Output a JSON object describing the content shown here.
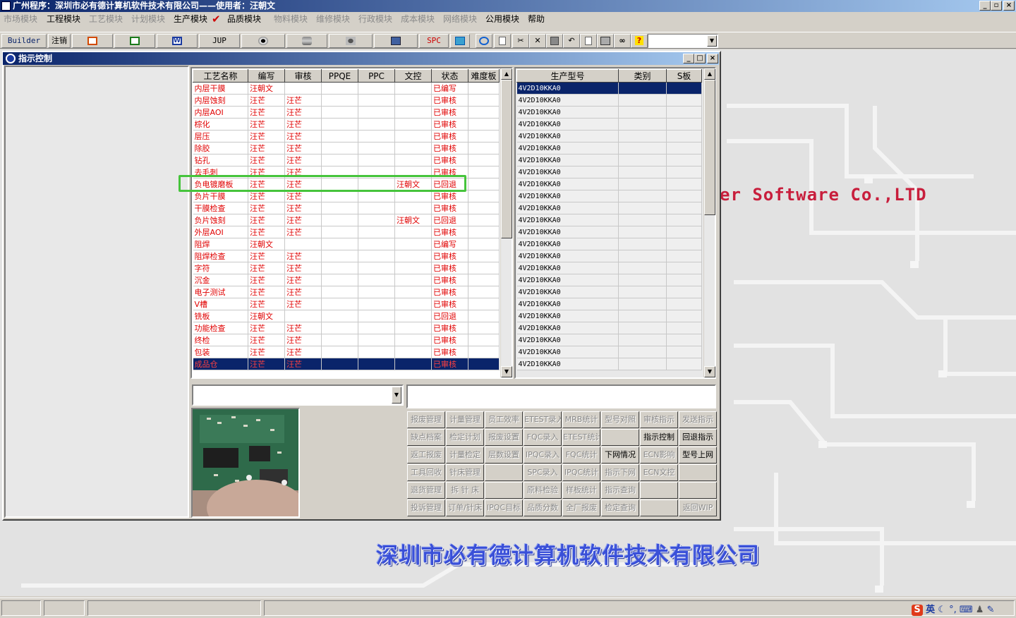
{
  "app": {
    "title": "广州程序：深圳市必有德计算机软件技术有限公司——使用者：汪朝文"
  },
  "menu": [
    {
      "label": "市场模块",
      "enabled": false
    },
    {
      "label": "工程模块",
      "enabled": true
    },
    {
      "label": "工艺模块",
      "enabled": false
    },
    {
      "label": "计划模块",
      "enabled": false
    },
    {
      "label": "生产模块",
      "enabled": true
    },
    {
      "label": "品质模块",
      "enabled": true
    },
    {
      "label": "物料模块",
      "enabled": false
    },
    {
      "label": "维修模块",
      "enabled": false
    },
    {
      "label": "行政模块",
      "enabled": false
    },
    {
      "label": "成本模块",
      "enabled": false
    },
    {
      "label": "网络模块",
      "enabled": false
    },
    {
      "label": "公用模块",
      "enabled": true
    },
    {
      "label": "帮助",
      "enabled": true
    }
  ],
  "toolbar": {
    "builder": "Builder",
    "logout": "注销",
    "jup": "JUP",
    "spc": "SPC"
  },
  "window": {
    "title": "指示控制"
  },
  "process_grid": {
    "headers": [
      "工艺名称",
      "编写",
      "审核",
      "PPQE",
      "PPC",
      "文控",
      "状态",
      "难度板"
    ],
    "rows": [
      [
        "内层干膜",
        "汪朝文",
        "",
        "",
        "",
        "",
        "已编写",
        ""
      ],
      [
        "内层蚀刻",
        "汪芒",
        "汪芒",
        "",
        "",
        "",
        "已审核",
        ""
      ],
      [
        "内层AOI",
        "汪芒",
        "汪芒",
        "",
        "",
        "",
        "已审核",
        ""
      ],
      [
        "棕化",
        "汪芒",
        "汪芒",
        "",
        "",
        "",
        "已审核",
        ""
      ],
      [
        "层压",
        "汪芒",
        "汪芒",
        "",
        "",
        "",
        "已审核",
        ""
      ],
      [
        "除胶",
        "汪芒",
        "汪芒",
        "",
        "",
        "",
        "已审核",
        ""
      ],
      [
        "钻孔",
        "汪芒",
        "汪芒",
        "",
        "",
        "",
        "已审核",
        ""
      ],
      [
        "去毛刺",
        "汪芒",
        "汪芒",
        "",
        "",
        "",
        "已审核",
        ""
      ],
      [
        "负电镀磨板",
        "汪芒",
        "汪芒",
        "",
        "",
        "汪朝文",
        "已回退",
        ""
      ],
      [
        "负片干膜",
        "汪芒",
        "汪芒",
        "",
        "",
        "",
        "已审核",
        ""
      ],
      [
        "干膜检查",
        "汪芒",
        "汪芒",
        "",
        "",
        "",
        "已审核",
        ""
      ],
      [
        "负片蚀刻",
        "汪芒",
        "汪芒",
        "",
        "",
        "汪朝文",
        "已回退",
        ""
      ],
      [
        "外层AOI",
        "汪芒",
        "汪芒",
        "",
        "",
        "",
        "已审核",
        ""
      ],
      [
        "阻焊",
        "汪朝文",
        "",
        "",
        "",
        "",
        "已编写",
        ""
      ],
      [
        "阻焊检查",
        "汪芒",
        "汪芒",
        "",
        "",
        "",
        "已审核",
        ""
      ],
      [
        "字符",
        "汪芒",
        "汪芒",
        "",
        "",
        "",
        "已审核",
        ""
      ],
      [
        "沉金",
        "汪芒",
        "汪芒",
        "",
        "",
        "",
        "已审核",
        ""
      ],
      [
        "电子测试",
        "汪芒",
        "汪芒",
        "",
        "",
        "",
        "已审核",
        ""
      ],
      [
        "V槽",
        "汪芒",
        "汪芒",
        "",
        "",
        "",
        "已审核",
        ""
      ],
      [
        "铣板",
        "汪朝文",
        "",
        "",
        "",
        "",
        "已回退",
        ""
      ],
      [
        "功能检查",
        "汪芒",
        "汪芒",
        "",
        "",
        "",
        "已审核",
        ""
      ],
      [
        "终检",
        "汪芒",
        "汪芒",
        "",
        "",
        "",
        "已审核",
        ""
      ],
      [
        "包装",
        "汪芒",
        "汪芒",
        "",
        "",
        "",
        "已审核",
        ""
      ],
      [
        "成品仓",
        "汪芒",
        "汪芒",
        "",
        "",
        "",
        "已审核",
        ""
      ]
    ],
    "selected_row": 23,
    "highlighted_row": 8
  },
  "model_grid": {
    "headers": [
      "生产型号",
      "类别",
      "S板"
    ],
    "rows": [
      "4V2D10KKA0",
      "4V2D10KKA0",
      "4V2D10KKA0",
      "4V2D10KKA0",
      "4V2D10KKA0",
      "4V2D10KKA0",
      "4V2D10KKA0",
      "4V2D10KKA0",
      "4V2D10KKA0",
      "4V2D10KKA0",
      "4V2D10KKA0",
      "4V2D10KKA0",
      "4V2D10KKA0",
      "4V2D10KKA0",
      "4V2D10KKA0",
      "4V2D10KKA0",
      "4V2D10KKA0",
      "4V2D10KKA0",
      "4V2D10KKA0",
      "4V2D10KKA0",
      "4V2D10KKA0",
      "4V2D10KKA0",
      "4V2D10KKA0",
      "4V2D10KKA0"
    ],
    "selected_row": 0
  },
  "function_buttons": [
    [
      {
        "label": "报废管理",
        "en": false
      },
      {
        "label": "计量管理",
        "en": false
      },
      {
        "label": "员工效率",
        "en": false
      },
      {
        "label": "ETEST录入",
        "en": false
      },
      {
        "label": "MRB统计",
        "en": false
      },
      {
        "label": "型号对照",
        "en": false
      },
      {
        "label": "审核指示",
        "en": false
      },
      {
        "label": "发送指示",
        "en": false
      }
    ],
    [
      {
        "label": "缺点档案",
        "en": false
      },
      {
        "label": "检定计划",
        "en": false
      },
      {
        "label": "报废设置",
        "en": false
      },
      {
        "label": "FQC录入",
        "en": false
      },
      {
        "label": "ETEST统计",
        "en": false
      },
      {
        "label": "",
        "en": false
      },
      {
        "label": "指示控制",
        "en": true
      },
      {
        "label": "回退指示",
        "en": true
      }
    ],
    [
      {
        "label": "返工报废",
        "en": false
      },
      {
        "label": "计量检定",
        "en": false
      },
      {
        "label": "层数设置",
        "en": false
      },
      {
        "label": "IPQC录入",
        "en": false
      },
      {
        "label": "FQC统计",
        "en": false
      },
      {
        "label": "下网情况",
        "en": true
      },
      {
        "label": "ECN影响",
        "en": false
      },
      {
        "label": "型号上网",
        "en": true
      }
    ],
    [
      {
        "label": "工具回收",
        "en": false
      },
      {
        "label": "针床管理",
        "en": false
      },
      {
        "label": "",
        "en": false
      },
      {
        "label": "SPC录入",
        "en": false
      },
      {
        "label": "IPQC统计",
        "en": false
      },
      {
        "label": "指示下网",
        "en": false
      },
      {
        "label": "ECN文控",
        "en": false
      },
      {
        "label": "",
        "en": false
      }
    ],
    [
      {
        "label": "退货管理",
        "en": false
      },
      {
        "label": "拆 针 床",
        "en": false
      },
      {
        "label": "",
        "en": false
      },
      {
        "label": "原料检验",
        "en": false
      },
      {
        "label": "样板统计",
        "en": false
      },
      {
        "label": "指示查询",
        "en": false
      },
      {
        "label": "",
        "en": false
      },
      {
        "label": "",
        "en": false
      }
    ],
    [
      {
        "label": "投诉管理",
        "en": false
      },
      {
        "label": "订单/针床",
        "en": false
      },
      {
        "label": "IPQC目标",
        "en": false
      },
      {
        "label": "品质分数",
        "en": false
      },
      {
        "label": "全厂报废",
        "en": false
      },
      {
        "label": "检定查询",
        "en": false
      },
      {
        "label": "",
        "en": false
      },
      {
        "label": "返回WIP",
        "en": false
      }
    ]
  ],
  "background": {
    "software_text": "er Software Co.,LTD",
    "company_text": "深圳市必有德计算机软件技术有限公司"
  },
  "tray": {
    "ime": "英"
  },
  "colors": {
    "titlebar_start": "#0a246a",
    "titlebar_end": "#a6caf0",
    "grid_text_red": "#e00000",
    "selection": "#0a246a",
    "highlight_green": "#46c43c",
    "company_blue": "#3a50d8",
    "software_red": "#c81e3c"
  }
}
